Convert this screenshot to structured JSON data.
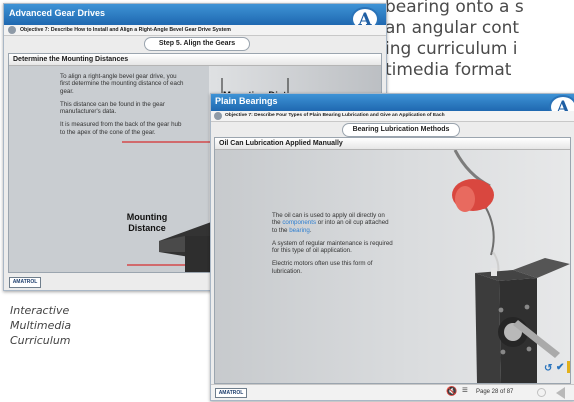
{
  "background_text": {
    "line1": "bearing onto a s",
    "line2": "an angular cont",
    "line3": "ing curriculum i",
    "line4": "timedia format"
  },
  "caption": {
    "line1": "Interactive",
    "line2": "Multimedia",
    "line3": "Curriculum"
  },
  "back_window": {
    "title": "Advanced Gear Drives",
    "objective": "Objective 7: Describe How to Install and Align a Right-Angle Bevel Gear Drive System",
    "step": "Step 5. Align the Gears",
    "panel_title": "Determine the Mounting Distances",
    "paragraphs": [
      "To align a right-angle bevel gear drive, you first determine the mounting distance of each gear.",
      "This distance can be found in the gear manufacturer's data.",
      "It is measured from the back of the gear hub to the apex of the cone of the gear."
    ],
    "diagram_label_top": "Mounting Distance",
    "diagram_label_left_1": "Mounting",
    "diagram_label_left_2": "Distance",
    "brand": "AMATROL"
  },
  "front_window": {
    "title": "Plain Bearings",
    "objective": "Objective 7: Describe Four Types of Plain Bearing Lubrication and Give an Application of Each",
    "step": "Bearing Lubrication Methods",
    "panel_title": "Oil Can Lubrication Applied Manually",
    "para1_part1": "The oil can is used to apply oil directly on the ",
    "para1_link1": "components",
    "para1_part2": " or into an oil cup attached to the ",
    "para1_link2": "bearing",
    "para1_part3": ".",
    "para2": "A system of regular maintenance is required for this type of oil application.",
    "para3": "Electric motors often use this form of lubrication.",
    "page_label": "Page 28 of 87",
    "brand": "AMATROL"
  },
  "colors": {
    "title_blue": "#2a7ac7",
    "link_blue": "#2f7fd0",
    "red_line": "#d63030",
    "oil_can_red": "#d9473f"
  },
  "icons": [
    "logo-a-icon",
    "chevron-icon",
    "refresh-icon",
    "check-icon",
    "mute-icon",
    "menu-icon",
    "play-icon",
    "prev-arrow-icon"
  ]
}
